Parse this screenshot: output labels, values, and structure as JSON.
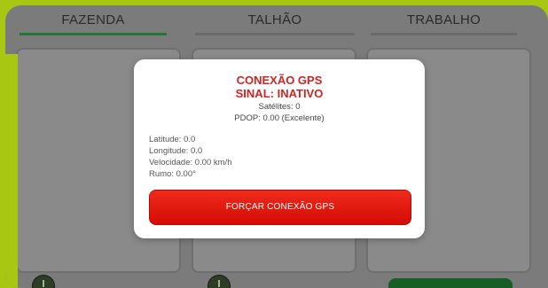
{
  "tabs": [
    {
      "label": "FAZENDA",
      "active": true
    },
    {
      "label": "TALHÃO",
      "active": false
    },
    {
      "label": "TRABALHO",
      "active": false
    }
  ],
  "gps_dialog": {
    "title_line1": "CONEXÃO GPS",
    "title_line2": "SINAL: INATIVO",
    "satellites": "Satélites: 0",
    "pdop": "PDOP: 0.00 (Excelente)",
    "latitude": "Latitude: 0.0",
    "longitude": "Longitude: 0.0",
    "speed": "Velocidade: 0.00 km/h",
    "heading": "Rumo: 0.00°",
    "force_button_label": "FORÇAR CONEXÃO GPS"
  },
  "colors": {
    "accent_lime": "#a7c713",
    "active_tab_green": "#1e7a33",
    "alert_red": "#d12421",
    "button_red": "#e81b10"
  }
}
